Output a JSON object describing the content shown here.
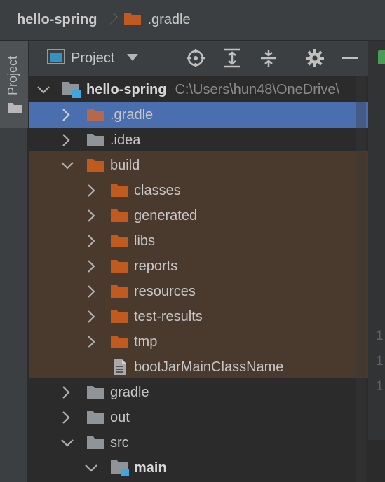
{
  "breadcrumb": {
    "project": "hello-spring",
    "current": ".gradle"
  },
  "tool_window": {
    "stripe_label": "Project",
    "view_title": "Project",
    "buttons": [
      "locate-icon",
      "expand-all-icon",
      "collapse-all-icon",
      "settings-icon",
      "minimize-icon"
    ]
  },
  "tree": {
    "root": {
      "name": "hello-spring",
      "path": "C:\\Users\\hun48\\OneDrive\\"
    },
    "items": [
      {
        "label": ".gradle",
        "state": "collapsed",
        "folder_color": "#b6694a",
        "selected": true
      },
      {
        "label": ".idea",
        "state": "collapsed",
        "folder_color": "#8f9499"
      },
      {
        "label": "build",
        "state": "expanded",
        "folder_color": "#c05a1f"
      },
      {
        "label": "classes",
        "state": "collapsed",
        "folder_color": "#c05a1f"
      },
      {
        "label": "generated",
        "state": "collapsed",
        "folder_color": "#c05a1f"
      },
      {
        "label": "libs",
        "state": "collapsed",
        "folder_color": "#c05a1f"
      },
      {
        "label": "reports",
        "state": "collapsed",
        "folder_color": "#c05a1f"
      },
      {
        "label": "resources",
        "state": "collapsed",
        "folder_color": "#c05a1f"
      },
      {
        "label": "test-results",
        "state": "collapsed",
        "folder_color": "#c05a1f"
      },
      {
        "label": "tmp",
        "state": "collapsed",
        "folder_color": "#c05a1f"
      },
      {
        "label": "bootJarMainClassName",
        "state": "file"
      },
      {
        "label": "gradle",
        "state": "collapsed",
        "folder_color": "#8f9499"
      },
      {
        "label": "out",
        "state": "collapsed",
        "folder_color": "#8f9499"
      },
      {
        "label": "src",
        "state": "expanded",
        "folder_color": "#8f9499"
      },
      {
        "label": "main",
        "state": "expanded",
        "folder_color": "#8f9499",
        "bold": true
      }
    ]
  },
  "gutter_numbers": [
    "1",
    "1",
    "1"
  ],
  "colors": {
    "selection": "#4b6eaf",
    "excluded_background": "#4a3a2d",
    "module_badge": "#3fa6e0"
  }
}
